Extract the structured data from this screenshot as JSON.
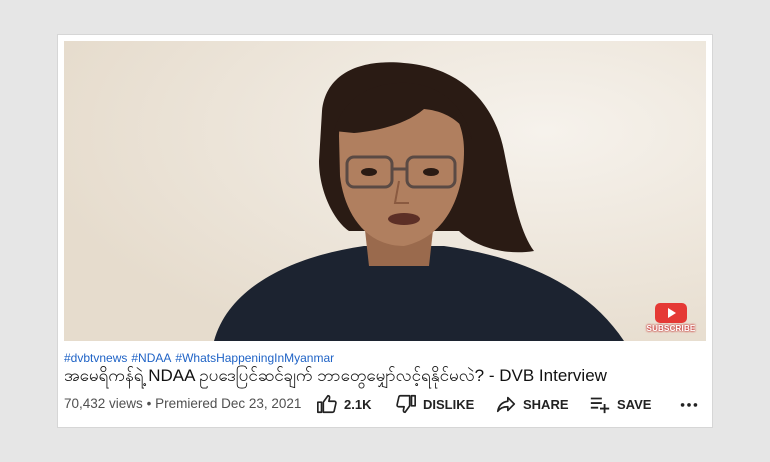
{
  "video": {
    "subscribe_label": "SUBSCRIBE",
    "accent": "#e53935"
  },
  "tags": [
    "#dvbtvnews",
    "#NDAA",
    "#WhatsHappeningInMyanmar"
  ],
  "title": "အမေရိကန်ရဲ့ NDAA ဥပဒေပြင်ဆင်ချက် ဘာတွေမျှော်လင့်ရနိုင်မလဲ? - DVB Interview",
  "meta": {
    "views": "70,432 views",
    "separator": "•",
    "premiered": "Premiered Dec 23, 2021"
  },
  "actions": {
    "like_count": "2.1K",
    "dislike_label": "DISLIKE",
    "share_label": "SHARE",
    "save_label": "SAVE"
  },
  "colors": {
    "tag_link": "#1f63c6",
    "background": "#e6e6e6"
  },
  "icons": [
    "thumb-up-icon",
    "thumb-down-icon",
    "share-arrow-icon",
    "playlist-add-icon",
    "more-horiz-icon",
    "youtube-play-icon"
  ]
}
